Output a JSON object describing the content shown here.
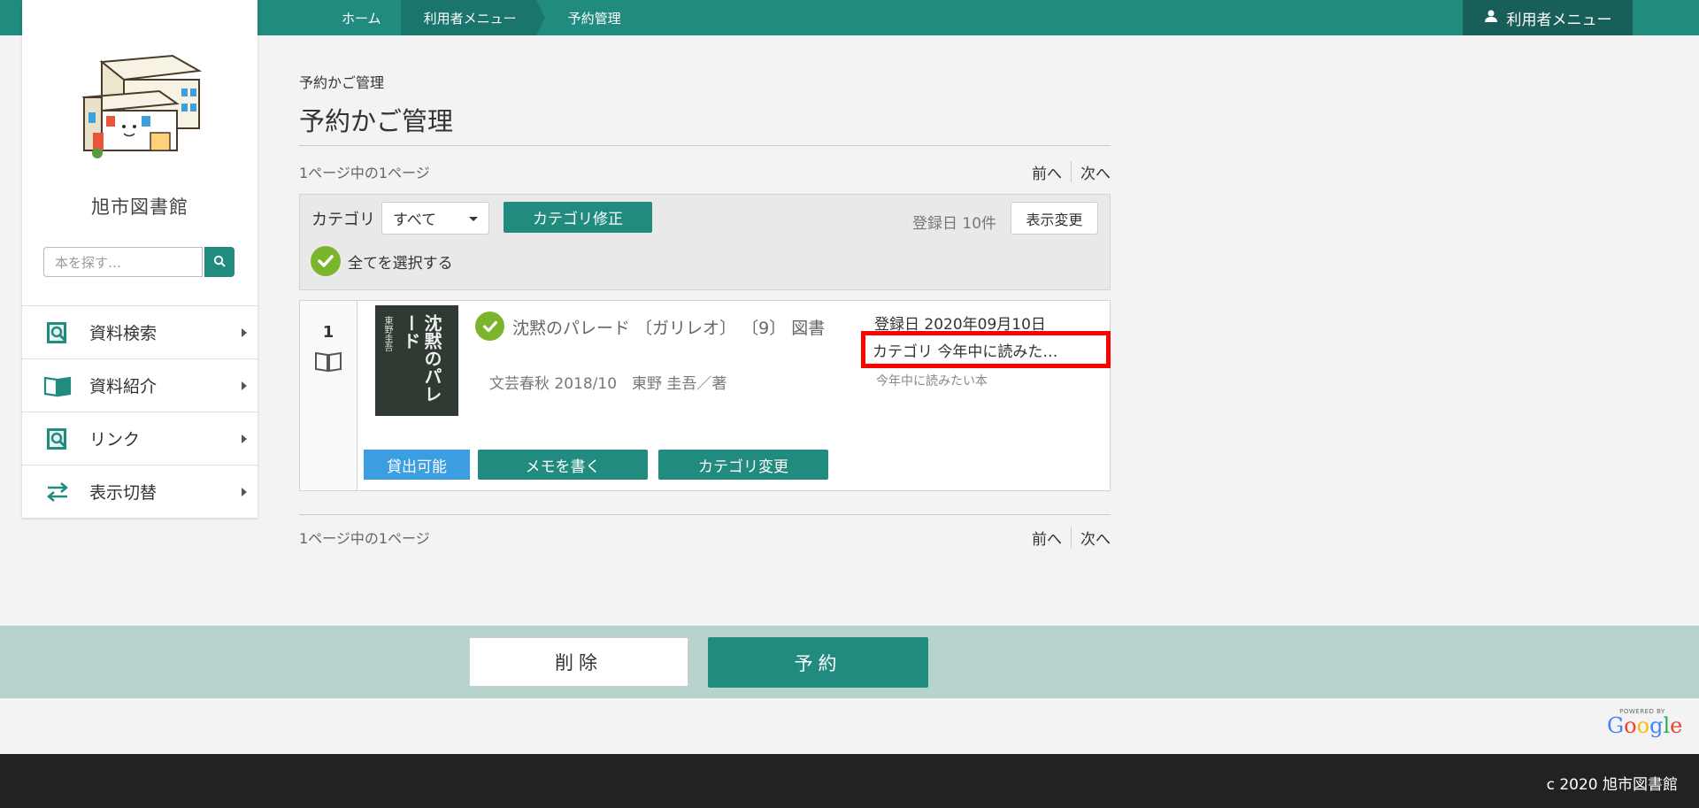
{
  "header": {
    "breadcrumbs": [
      "ホーム",
      "利用者メニュー",
      "予約管理"
    ],
    "user_menu_label": "利用者メニュー"
  },
  "sidebar": {
    "library_name": "旭市図書館",
    "search_placeholder": "本を探す…",
    "items": [
      {
        "label": "資料検索",
        "icon": "search-book-icon"
      },
      {
        "label": "資料紹介",
        "icon": "open-book-icon"
      },
      {
        "label": "リンク",
        "icon": "link-search-icon"
      },
      {
        "label": "表示切替",
        "icon": "swap-arrows-icon"
      }
    ]
  },
  "main": {
    "subtitle": "予約かご管理",
    "title": "予約かご管理",
    "page_info": "1ページ中の1ページ",
    "prev": "前へ",
    "next": "次へ",
    "filter": {
      "category_label": "カテゴリ",
      "category_value": "すべて",
      "category_fix_button": "カテゴリ修正",
      "sort_info": "登録日 10件",
      "display_change_button": "表示変更",
      "select_all_label": "全てを選択する"
    },
    "items": [
      {
        "number": "1",
        "cover_title": "沈黙のパレード",
        "cover_author": "東野圭吾",
        "title": "沈黙のパレード 〔ガリレオ〕 〔9〕 図書",
        "publisher_info": "文芸春秋 2018/10　東野 圭吾／著",
        "registered": "登録日 2020年09月10日",
        "category": "カテゴリ  今年中に読みた…",
        "category_sub": "今年中に読みたい本",
        "status": "貸出可能",
        "memo_button": "メモを書く",
        "category_change_button": "カテゴリ変更"
      }
    ]
  },
  "actions": {
    "delete": "削除",
    "reserve": "予約"
  },
  "footer": {
    "powered_by": "POWERED BY",
    "google": "Google",
    "copyright": "c 2020 旭市図書館"
  },
  "colors": {
    "teal": "#218b80",
    "check_green": "#7ab52c",
    "available_blue": "#3a9ee0",
    "highlight_red": "#ff0000"
  }
}
